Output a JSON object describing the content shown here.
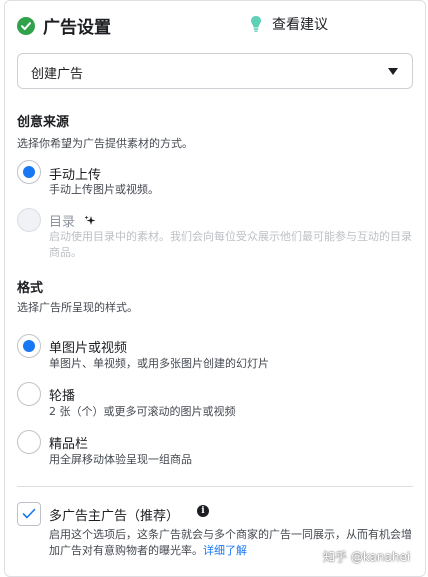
{
  "header": {
    "title": "广告设置",
    "tips_label": "查看建议"
  },
  "dropdown": {
    "selected": "创建广告"
  },
  "creative_source": {
    "title": "创意来源",
    "description": "选择你希望为广告提供素材的方式。",
    "options": [
      {
        "label": "手动上传",
        "description": "手动上传图片或视频。",
        "selected": true,
        "disabled": false
      },
      {
        "label": "目录",
        "description": "启动使用目录中的素材。我们会向每位受众展示他们最可能参与互动的目录商品。",
        "selected": false,
        "disabled": true
      }
    ]
  },
  "format": {
    "title": "格式",
    "description": "选择广告所呈现的样式。",
    "options": [
      {
        "label": "单图片或视频",
        "description": "单图片、单视频，或用多张图片创建的幻灯片",
        "selected": true
      },
      {
        "label": "轮播",
        "description": "2 张（个）或更多可滚动的图片或视频",
        "selected": false
      },
      {
        "label": "精品栏",
        "description": "用全屏移动体验呈现一组商品",
        "selected": false
      }
    ]
  },
  "multi_advertiser": {
    "label": "多广告主广告（推荐）",
    "checked": true,
    "description": "启用这个选项后，这条广告就会与多个商家的广告一同展示，从而有机会增加广告对有意购物者的曝光率。",
    "learn_more": "详细了解"
  },
  "watermark": "知乎 @kanahei",
  "colors": {
    "accent": "#1877f2",
    "success": "#31a24c",
    "bulb": "#5dd0b6"
  }
}
